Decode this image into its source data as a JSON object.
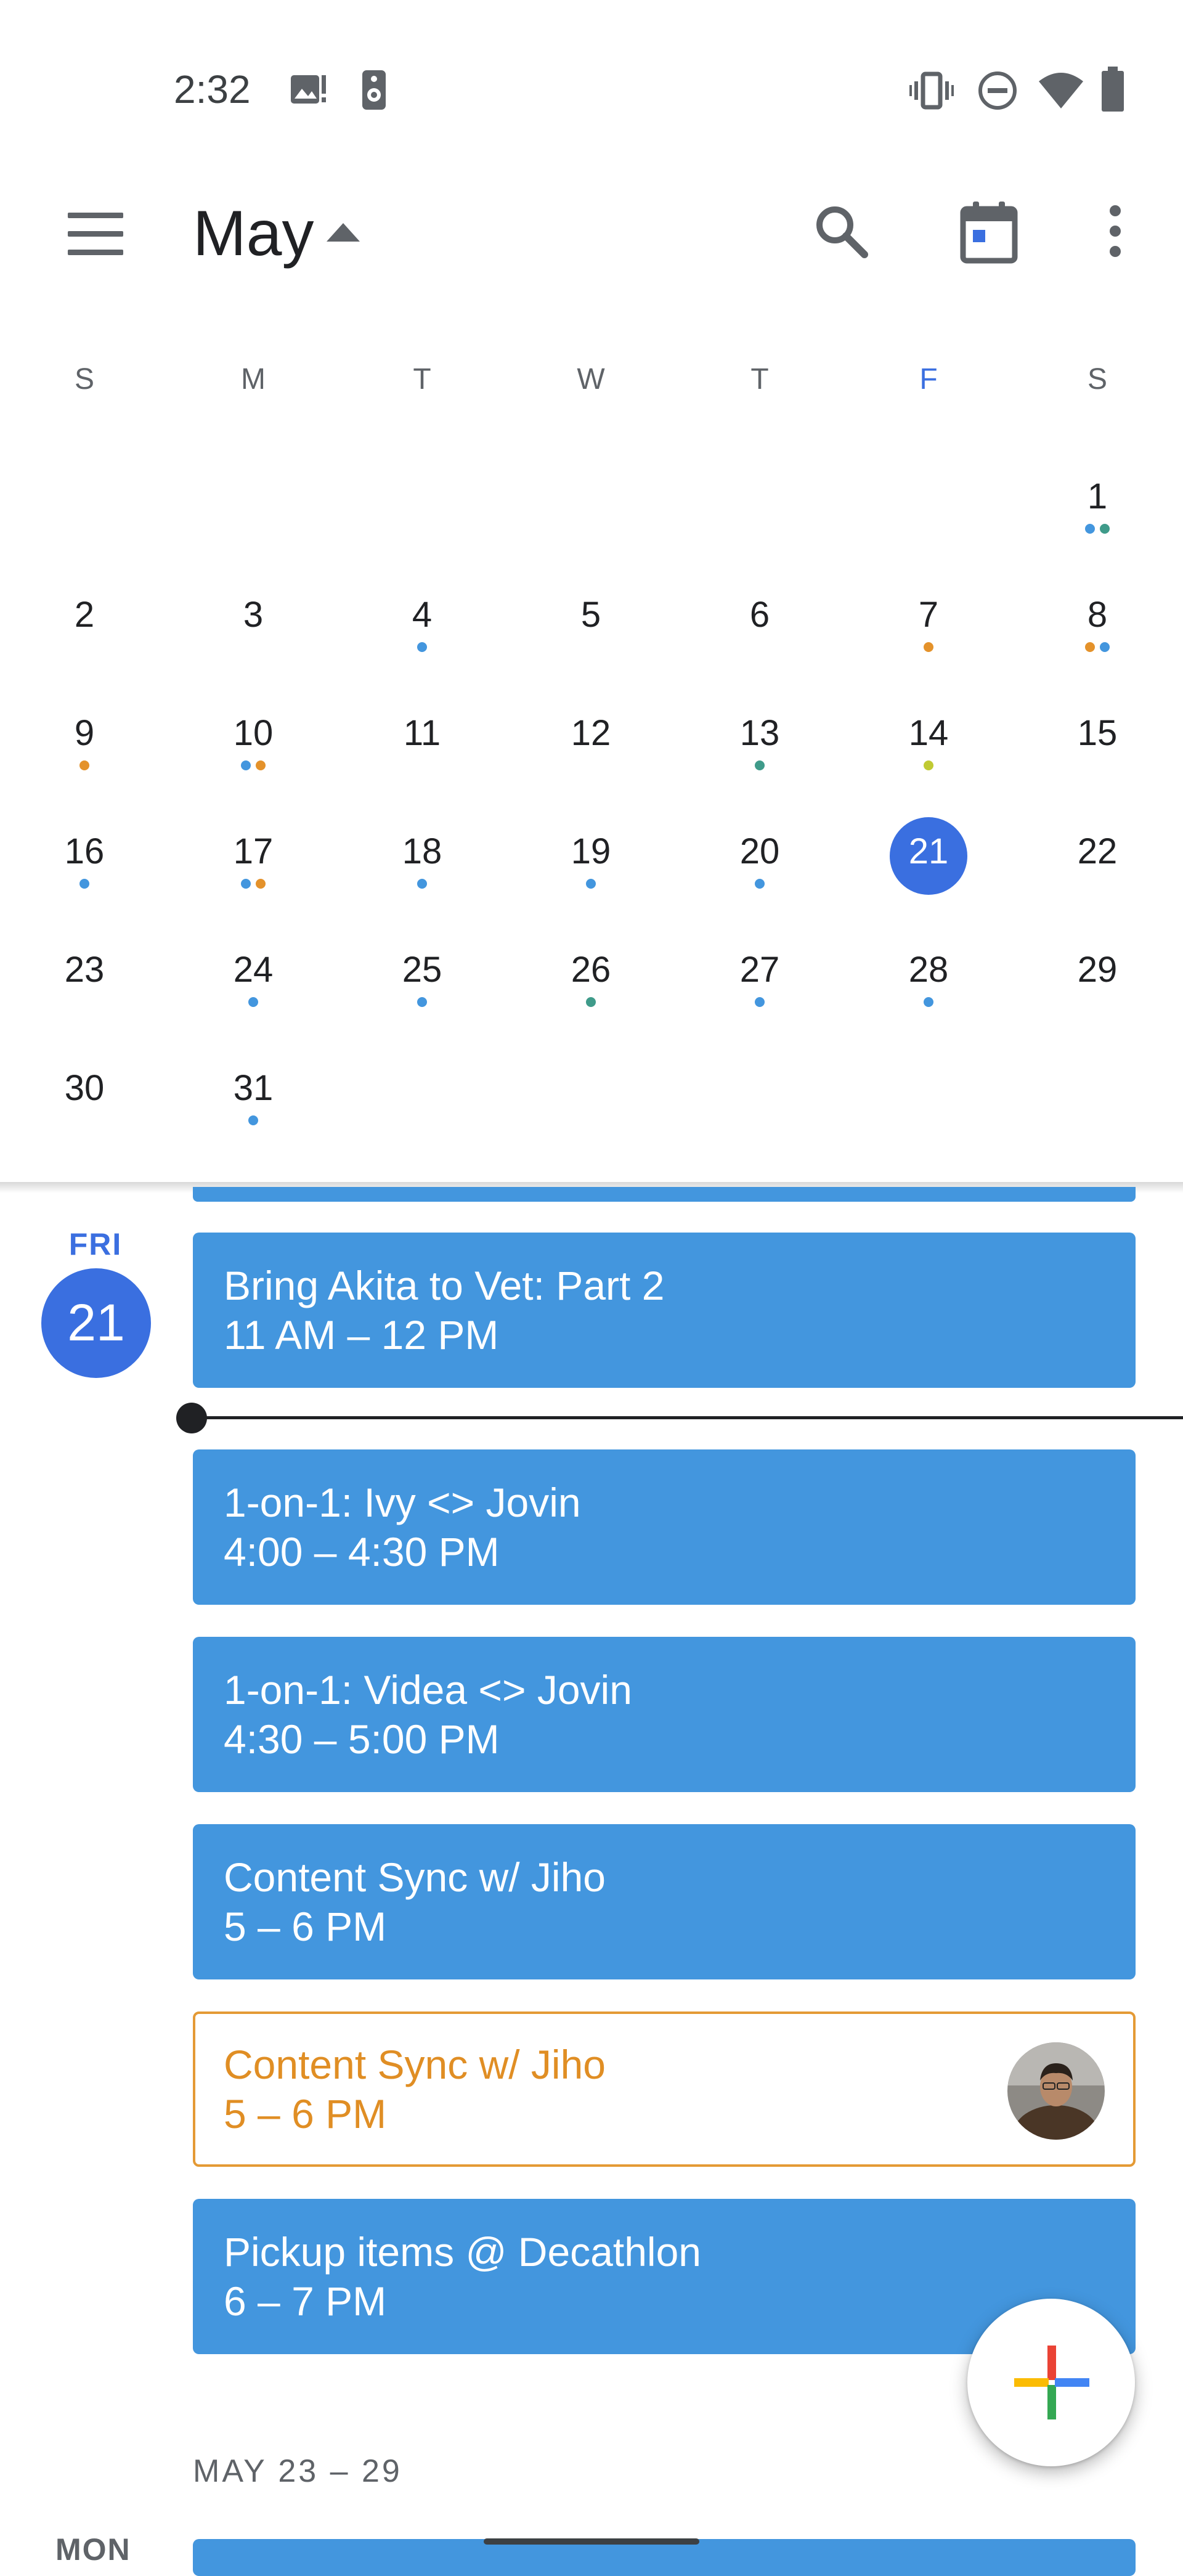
{
  "status_bar": {
    "time": "2:32",
    "left_icons": [
      "photo-alert-icon",
      "speaker-icon"
    ],
    "right_icons": [
      "vibrate-icon",
      "do-not-disturb-icon",
      "wifi-icon",
      "battery-icon"
    ]
  },
  "app_bar": {
    "month": "May",
    "icons": [
      "menu-icon",
      "arrow-drop-up-icon",
      "search-icon",
      "today-icon",
      "more-vert-icon"
    ]
  },
  "mini_calendar": {
    "weekdays": [
      "S",
      "M",
      "T",
      "W",
      "T",
      "F",
      "S"
    ],
    "today": "21",
    "weeks": [
      [
        null,
        null,
        null,
        null,
        null,
        null,
        {
          "d": "1",
          "dots": [
            "#4396de",
            "#3f9b8a"
          ]
        }
      ],
      [
        {
          "d": "2",
          "dots": []
        },
        {
          "d": "3",
          "dots": []
        },
        {
          "d": "4",
          "dots": [
            "#4396de"
          ]
        },
        {
          "d": "5",
          "dots": []
        },
        {
          "d": "6",
          "dots": []
        },
        {
          "d": "7",
          "dots": [
            "#e4922b"
          ]
        },
        {
          "d": "8",
          "dots": [
            "#e4922b",
            "#4396de"
          ]
        }
      ],
      [
        {
          "d": "9",
          "dots": [
            "#e4922b"
          ]
        },
        {
          "d": "10",
          "dots": [
            "#4396de",
            "#e4922b"
          ]
        },
        {
          "d": "11",
          "dots": []
        },
        {
          "d": "12",
          "dots": []
        },
        {
          "d": "13",
          "dots": [
            "#3f9b8a"
          ]
        },
        {
          "d": "14",
          "dots": [
            "#c0ca33"
          ]
        },
        {
          "d": "15",
          "dots": []
        }
      ],
      [
        {
          "d": "16",
          "dots": [
            "#4396de"
          ]
        },
        {
          "d": "17",
          "dots": [
            "#4396de",
            "#e4922b"
          ]
        },
        {
          "d": "18",
          "dots": [
            "#4396de"
          ]
        },
        {
          "d": "19",
          "dots": [
            "#4396de"
          ]
        },
        {
          "d": "20",
          "dots": [
            "#4396de"
          ]
        },
        {
          "d": "21",
          "dots": []
        },
        {
          "d": "22",
          "dots": []
        }
      ],
      [
        {
          "d": "23",
          "dots": []
        },
        {
          "d": "24",
          "dots": [
            "#4396de"
          ]
        },
        {
          "d": "25",
          "dots": [
            "#4396de"
          ]
        },
        {
          "d": "26",
          "dots": [
            "#3f9b8a"
          ]
        },
        {
          "d": "27",
          "dots": [
            "#4396de"
          ]
        },
        {
          "d": "28",
          "dots": [
            "#4396de"
          ]
        },
        {
          "d": "29",
          "dots": []
        }
      ],
      [
        {
          "d": "30",
          "dots": []
        },
        {
          "d": "31",
          "dots": [
            "#4396de"
          ]
        },
        null,
        null,
        null,
        null,
        null
      ]
    ]
  },
  "agenda": {
    "day_of_week": "FRI",
    "date": "21",
    "events": [
      {
        "title": "Bring Akita to Vet: Part 2",
        "time": "11 AM – 12 PM",
        "style": "filled"
      },
      {
        "title": "1-on-1: Ivy <> Jovin",
        "time": "4:00 – 4:30 PM",
        "style": "filled"
      },
      {
        "title": "1-on-1: Videa <> Jovin",
        "time": "4:30 – 5:00 PM",
        "style": "filled"
      },
      {
        "title": "Content Sync w/ Jiho",
        "time": "5 – 6 PM",
        "style": "filled"
      },
      {
        "title": "Content Sync w/ Jiho",
        "time": "5 – 6 PM",
        "style": "outlined"
      },
      {
        "title": "Pickup items @ Decathlon",
        "time": "6 – 7 PM",
        "style": "filled"
      }
    ],
    "next_week_label": "MAY 23 – 29",
    "next_day_label": "MON"
  },
  "colors": {
    "accent": "#3a6fe0",
    "event_blue": "#4396de",
    "pending_orange": "#e08e24"
  }
}
